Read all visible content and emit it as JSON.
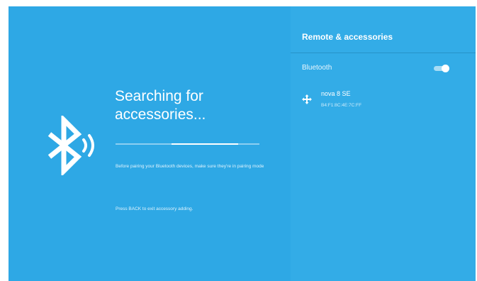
{
  "left": {
    "title": "Searching for accessories...",
    "hint": "Before pairing your Bluetooth devices, make sure they're in pairing mode",
    "back_hint": "Press BACK to exit accessory adding.",
    "bluetooth_icon": "bluetooth-searching-icon",
    "progress": {
      "indeterminate": true,
      "visible_start_fraction": 0.39,
      "visible_end_fraction": 0.85
    }
  },
  "panel": {
    "title": "Remote & accessories",
    "bluetooth": {
      "label": "Bluetooth",
      "enabled": true
    },
    "devices": [
      {
        "name": "nova 8 SE",
        "address": "B4:F1:8C:4E:7C:FF",
        "icon": "gamepad-icon"
      }
    ]
  },
  "colors": {
    "background": "#2ea8e5",
    "panel": "#33ace7",
    "text": "#ffffff"
  }
}
